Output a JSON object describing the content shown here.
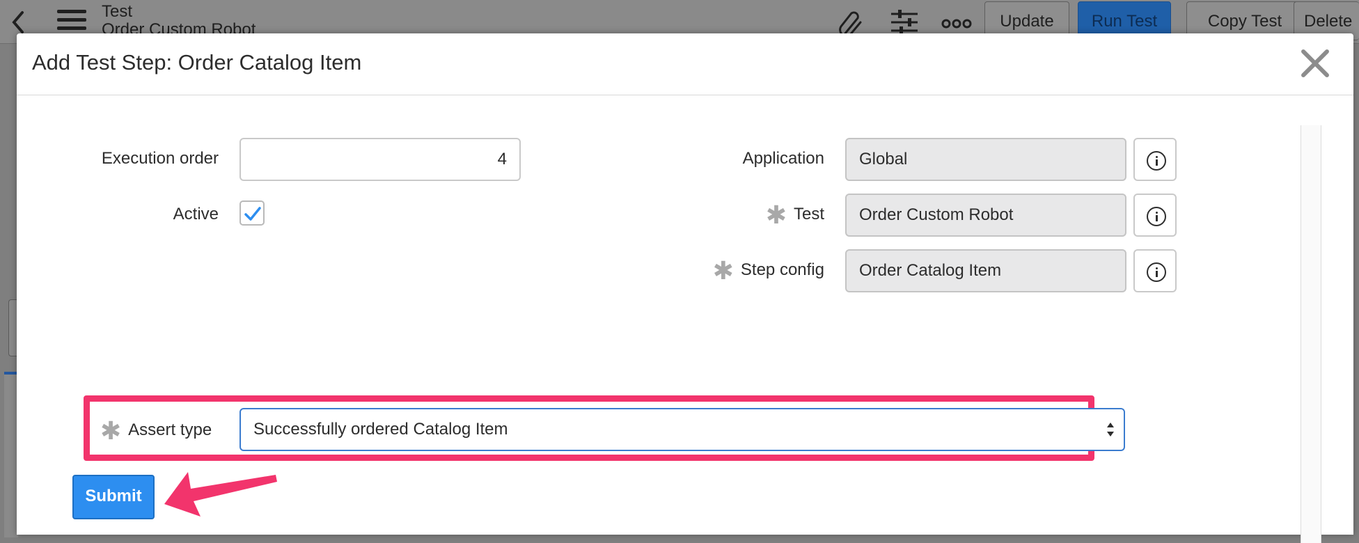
{
  "background": {
    "title": "Test",
    "subtitle": "Order Custom Robot",
    "buttons": {
      "update": "Update",
      "run_test": "Run Test",
      "copy_test": "Copy Test",
      "delete": "Delete"
    },
    "icons": [
      "back-chevron-icon",
      "hamburger-menu-icon",
      "paperclip-icon",
      "sliders-icon",
      "more-options-icon"
    ]
  },
  "modal": {
    "title": "Add Test Step: Order Catalog Item",
    "fields": {
      "execution_order": {
        "label": "Execution order",
        "value": "4"
      },
      "active": {
        "label": "Active",
        "checked": true
      },
      "application": {
        "label": "Application",
        "value": "Global"
      },
      "test": {
        "label": "Test",
        "value": "Order Custom Robot",
        "required": true
      },
      "step_config": {
        "label": "Step config",
        "value": "Order Catalog Item",
        "required": true
      },
      "assert_type": {
        "label": "Assert type",
        "value": "Successfully ordered Catalog Item",
        "required": true
      }
    },
    "submit_label": "Submit",
    "required_marker": "✱"
  },
  "colors": {
    "highlight": "#f2346c",
    "primary": "#2d8ef0",
    "checkmark": "#2d8ef0"
  }
}
